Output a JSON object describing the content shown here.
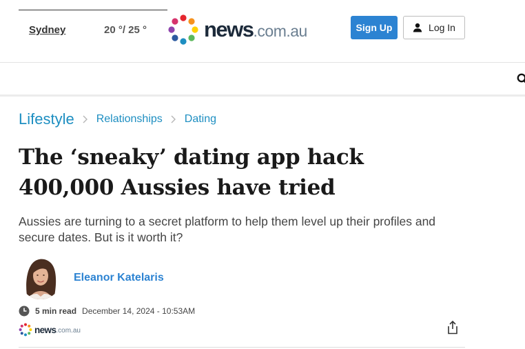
{
  "header": {
    "location": "Sydney",
    "temperature": "20 °/ 25 °",
    "logo_word": "news",
    "logo_tld": ".com.au",
    "signup_label": "Sign Up",
    "login_label": "Log In"
  },
  "colors": {
    "link_blue": "#1d8ec1",
    "button_blue": "#2c83d2",
    "logo_dots": [
      "#e5262e",
      "#f6921e",
      "#ffd100",
      "#5cb85c",
      "#1d8ec1",
      "#2c5aa0",
      "#8e44ad",
      "#d6336c"
    ]
  },
  "icons": {
    "search": "search-icon",
    "user": "user-icon",
    "chevron": "chevron-right-icon",
    "clock": "clock-icon",
    "share": "share-icon"
  },
  "breadcrumb": {
    "section": "Lifestyle",
    "items": [
      "Relationships",
      "Dating"
    ]
  },
  "article": {
    "headline": "The ‘sneaky’ dating app hack 400,000 Aussies have tried",
    "standfirst": "Aussies are turning to a secret platform to help them level up their profiles and secure dates. But is it worth it?",
    "author": "Eleanor Katelaris",
    "read_time": "5 min read",
    "date": "December 14, 2024 - 10:53AM",
    "source_word": "news",
    "source_tld": ".com.au"
  }
}
